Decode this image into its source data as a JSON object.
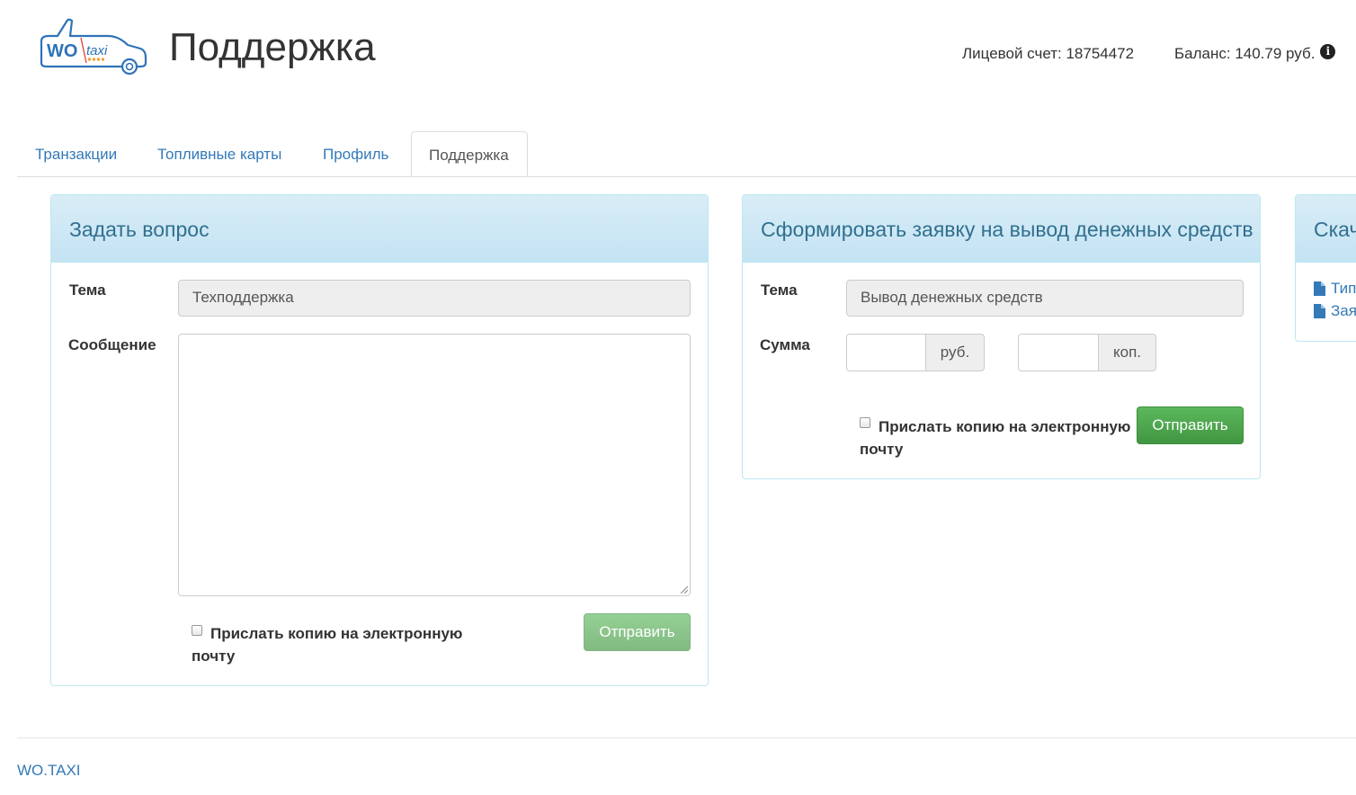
{
  "header": {
    "logo_text_wo": "WO",
    "logo_text_taxi": "taxi",
    "title": "Поддержка",
    "account": "Лицевой счет: 18754472",
    "balance": "Баланс: 140.79 руб.",
    "info_icon_glyph": "i"
  },
  "tabs": [
    {
      "label": "Транзакции",
      "active": false
    },
    {
      "label": "Топливные карты",
      "active": false
    },
    {
      "label": "Профиль",
      "active": false
    },
    {
      "label": "Поддержка",
      "active": true
    }
  ],
  "ask_panel": {
    "title": "Задать вопрос",
    "topic_label": "Тема",
    "topic_value": "Техподдержка",
    "message_label": "Сообщение",
    "message_value": "",
    "copy_line1": "Прислать копию на электронную",
    "copy_line2": "почту",
    "submit_label": "Отправить"
  },
  "withdraw_panel": {
    "title": "Сформировать заявку на вывод денежных средств",
    "topic_label": "Тема",
    "topic_value": "Вывод денежных средств",
    "amount_label": "Сумма",
    "rub_addon": "руб.",
    "kop_addon": "коп.",
    "copy_line1": "Прислать копию на электронную",
    "copy_line2": "почту",
    "submit_label": "Отправить"
  },
  "download_panel": {
    "title": "Скачать",
    "links": [
      {
        "label": "Типовой договор"
      },
      {
        "label": "Заявление"
      }
    ]
  },
  "footer": {
    "link": "WO.TAXI"
  },
  "colors": {
    "link": "#337ab7",
    "panel_heading_text": "#31708f",
    "panel_border": "#bce8f1",
    "success": "#5cb85c"
  }
}
